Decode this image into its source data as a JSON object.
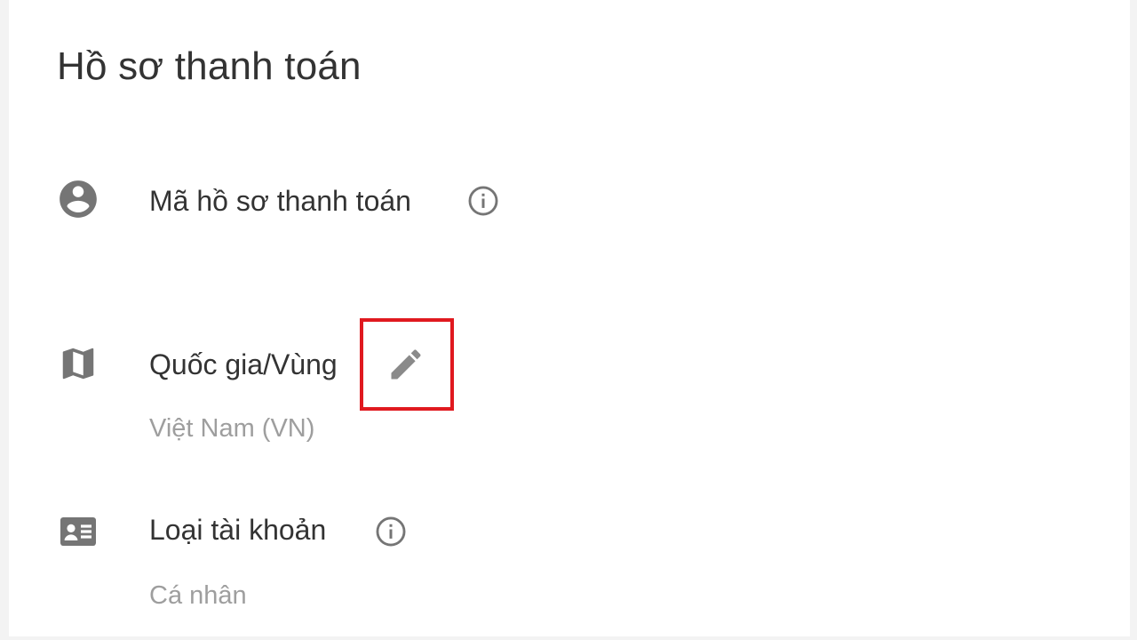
{
  "header": {
    "title": "Hồ sơ thanh toán"
  },
  "rows": [
    {
      "icon": "account-circle-icon",
      "label": "Mã hồ sơ thanh toán",
      "has_info": true
    },
    {
      "icon": "map-icon",
      "label": "Quốc gia/Vùng",
      "value": "Việt Nam (VN)",
      "has_edit": true
    },
    {
      "icon": "id-card-icon",
      "label": "Loại tài khoản",
      "value": "Cá nhân",
      "has_info": true
    }
  ],
  "colors": {
    "icon": "#757575",
    "title_text": "#333333",
    "secondary_text": "#9e9e9e",
    "highlight": "#e0191f"
  }
}
